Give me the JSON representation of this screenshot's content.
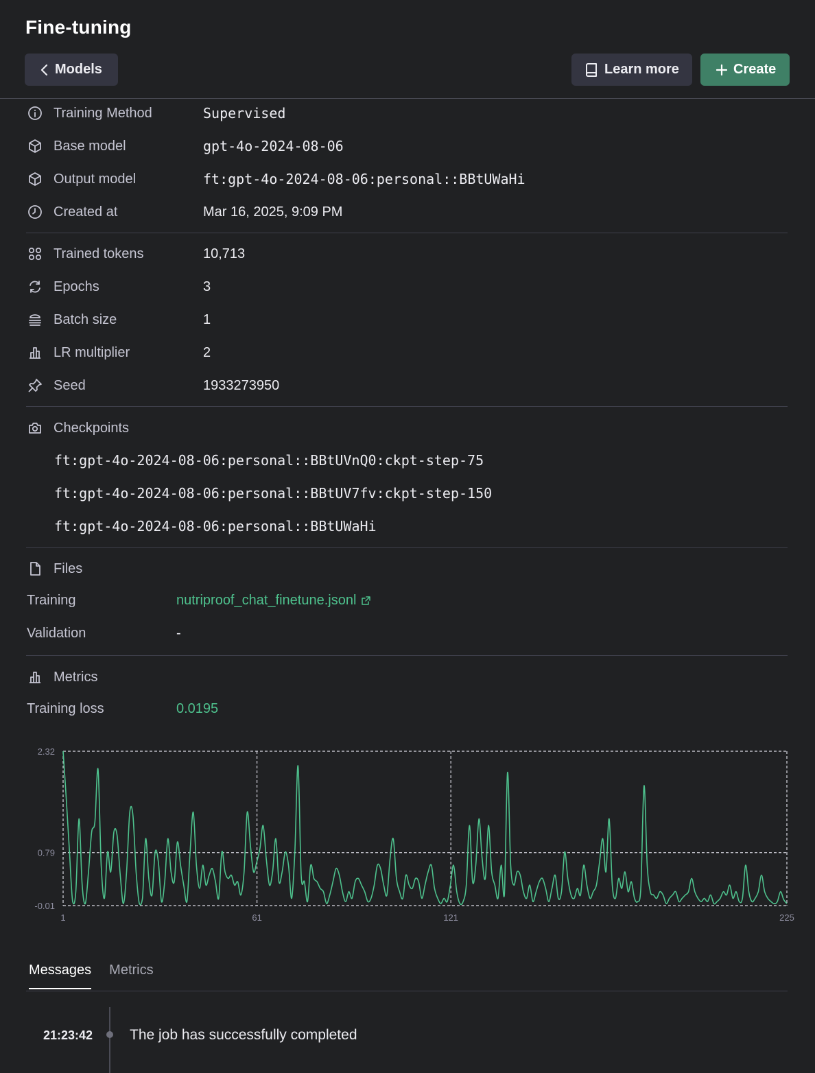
{
  "header": {
    "title": "Fine-tuning",
    "back_label": "Models",
    "learn_more_label": "Learn more",
    "create_label": "Create"
  },
  "details": {
    "training_method": {
      "label": "Training Method",
      "value": "Supervised"
    },
    "base_model": {
      "label": "Base model",
      "value": "gpt-4o-2024-08-06"
    },
    "output_model": {
      "label": "Output model",
      "value": "ft:gpt-4o-2024-08-06:personal::BBtUWaHi"
    },
    "created_at": {
      "label": "Created at",
      "value": "Mar 16, 2025, 9:09 PM"
    }
  },
  "hyperparams": {
    "trained_tokens": {
      "label": "Trained tokens",
      "value": "10,713"
    },
    "epochs": {
      "label": "Epochs",
      "value": "3"
    },
    "batch_size": {
      "label": "Batch size",
      "value": "1"
    },
    "lr_multiplier": {
      "label": "LR multiplier",
      "value": "2"
    },
    "seed": {
      "label": "Seed",
      "value": "1933273950"
    }
  },
  "checkpoints": {
    "label": "Checkpoints",
    "items": [
      "ft:gpt-4o-2024-08-06:personal::BBtUVnQ0:ckpt-step-75",
      "ft:gpt-4o-2024-08-06:personal::BBtUV7fv:ckpt-step-150",
      "ft:gpt-4o-2024-08-06:personal::BBtUWaHi"
    ]
  },
  "files": {
    "label": "Files",
    "training": {
      "label": "Training",
      "value": "nutriproof_chat_finetune.jsonl"
    },
    "validation": {
      "label": "Validation",
      "value": "-"
    }
  },
  "metrics": {
    "label": "Metrics",
    "training_loss": {
      "label": "Training loss",
      "value": "0.0195"
    }
  },
  "colors": {
    "accent": "#3f8066",
    "line": "#4ec18d",
    "background": "#202123"
  },
  "chart_data": {
    "type": "line",
    "title": "",
    "xlabel": "",
    "ylabel": "",
    "xlim": [
      1,
      225
    ],
    "ylim": [
      -0.01,
      2.32
    ],
    "x_ticks": [
      "1",
      "61",
      "121",
      "225"
    ],
    "y_ticks": [
      "2.32",
      "0.79",
      "-0.01"
    ],
    "grid": "dashed",
    "series": [
      {
        "values": [
          2.32,
          1.6,
          0.8,
          0.05,
          0.2,
          1.3,
          0.3,
          0.02,
          0.5,
          1.1,
          1.25,
          2.05,
          0.6,
          0.1,
          0.8,
          0.5,
          1.1,
          1.05,
          0.45,
          0.02,
          0.5,
          1.4,
          1.35,
          0.5,
          0.02,
          0.1,
          1.0,
          0.4,
          0.15,
          0.8,
          0.65,
          0.05,
          0.35,
          1.0,
          0.5,
          0.35,
          0.95,
          0.6,
          0.3,
          0.05,
          0.8,
          1.4,
          0.6,
          0.25,
          0.6,
          0.3,
          0.45,
          0.55,
          0.35,
          0.1,
          0.8,
          0.5,
          0.4,
          0.45,
          0.3,
          0.35,
          0.15,
          0.5,
          1.4,
          0.9,
          0.5,
          0.65,
          0.85,
          1.2,
          0.7,
          0.3,
          0.5,
          1.0,
          0.35,
          0.5,
          0.8,
          0.6,
          0.1,
          0.8,
          2.1,
          0.45,
          0.35,
          0.05,
          0.6,
          0.4,
          0.35,
          0.25,
          0.2,
          0.02,
          0.15,
          0.35,
          0.55,
          0.45,
          0.2,
          0.05,
          0.2,
          0.1,
          0.35,
          0.4,
          0.3,
          0.2,
          0.05,
          0.1,
          0.3,
          0.6,
          0.55,
          0.3,
          0.15,
          0.7,
          1.0,
          0.4,
          0.2,
          0.1,
          0.45,
          0.3,
          0.25,
          0.4,
          0.35,
          0.1,
          0.3,
          0.5,
          0.6,
          0.25,
          0.1,
          0.02,
          0.1,
          0.05,
          0.3,
          0.6,
          0.2,
          0.02,
          0.05,
          0.3,
          1.2,
          0.35,
          0.6,
          1.3,
          0.7,
          0.4,
          1.2,
          0.5,
          0.3,
          0.1,
          0.6,
          0.15,
          2.0,
          0.6,
          0.3,
          0.5,
          0.45,
          0.2,
          0.1,
          0.3,
          0.05,
          0.2,
          0.35,
          0.4,
          0.25,
          0.05,
          0.25,
          0.45,
          0.1,
          0.2,
          0.8,
          0.4,
          0.15,
          0.1,
          0.25,
          0.15,
          0.6,
          0.3,
          0.1,
          0.2,
          0.3,
          0.65,
          1.0,
          0.5,
          1.3,
          0.3,
          0.1,
          0.4,
          0.25,
          0.5,
          0.2,
          0.35,
          0.1,
          0.05,
          0.25,
          1.8,
          0.6,
          0.2,
          0.15,
          0.1,
          0.2,
          0.15,
          0.02,
          0.1,
          0.15,
          0.2,
          0.05,
          0.1,
          0.15,
          0.2,
          0.4,
          0.2,
          0.1,
          0.05,
          0.1,
          0.05,
          0.15,
          0.02,
          0.05,
          0.1,
          0.2,
          0.15,
          0.3,
          0.1,
          0.2,
          0.05,
          0.1,
          0.6,
          0.2,
          0.05,
          0.1,
          0.2,
          0.45,
          0.2,
          0.1,
          0.05,
          0.02,
          0.05,
          0.2,
          0.08,
          0.02
        ]
      }
    ]
  }
}
